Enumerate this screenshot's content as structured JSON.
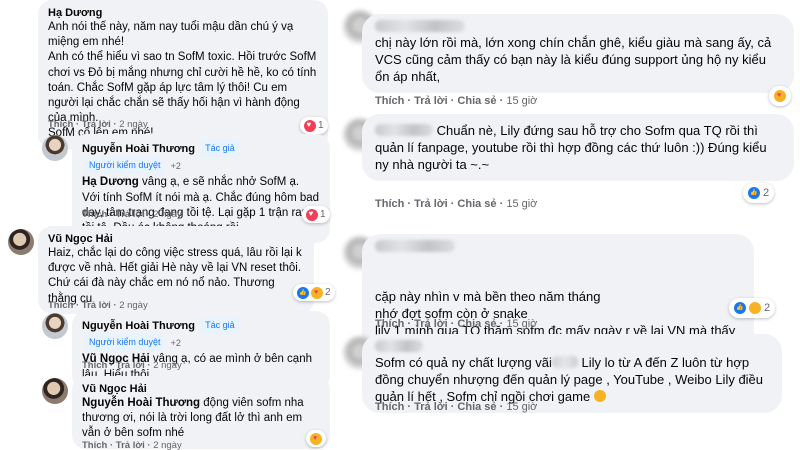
{
  "left": {
    "c1": {
      "author": "Hạ Dương",
      "text": "Anh nói thế này, năm nay tuổi mậu dần chú ý vạ miệng em nhé!\nAnh có thể hiểu vì sao tn SofM toxic. Hồi trước SofM chơi vs Đỏ bị mắng nhưng chỉ cười hề hề, ko có tính toán. Chắc SofM gặp áp lực tâm lý thôi! Cu em người lại chắc chắn sẽ thấy hối hận vì hành động của mình.\nSofM cố lên em nhé!",
      "like": "Thích",
      "reply": "Trả lời",
      "time": "2 ngày",
      "react_count": "1"
    },
    "c2": {
      "author": "Nguyễn Hoài Thương",
      "badge1": "Tác giả",
      "badge2": "Người kiểm duyệt",
      "badge_plus": "+2",
      "mention": "Hạ Dương",
      "text": " vâng ạ, e sẽ nhắc nhở SofM ạ. Với tính SofM ít nói mà ạ. Chắc đúng hôm bad day, tâm trạng đang tồi tệ. Lại gặp 1 trận rank tồi tệ. Đầu óc không thoáng rồi.",
      "like": "Thích",
      "reply": "Trả lời",
      "time": "2 ngày",
      "react_count": "1"
    },
    "c3": {
      "author": "Vũ Ngọc Hải",
      "text": "Haiz, chắc lại do công việc stress quá, lâu rồi lại k được về nhà. Hết giải Hè này về lại VN reset thôi. Chứ cái đà này chắc em nó nổ nảo. Thương thằng cu",
      "like": "Thích",
      "reply": "Trả lời",
      "time": "2 ngày",
      "react_count": "2"
    },
    "c4": {
      "author": "Nguyễn Hoài Thương",
      "badge1": "Tác giả",
      "badge2": "Người kiểm duyệt",
      "badge_plus": "+2",
      "mention": "Vũ Ngọc Hải",
      "text": " vâng ạ, có ae mình ở bên cạnh lâu. Hiểu thôi.",
      "like": "Thích",
      "reply": "Trả lời",
      "time": "2 ngày"
    },
    "c5": {
      "author": "Vũ Ngọc Hải",
      "mention": "Nguyễn Hoài Thương",
      "text": " động viên sofm nha thương ơi, nói là trời long đất lở thì anh em vẫn ở bên sofm nhé",
      "like": "Thích",
      "reply": "Trả lời",
      "time": "2 ngày"
    }
  },
  "right": {
    "r1": {
      "text": "chị này lớn rồi mà, lớn xong chín chắn ghê, kiểu giàu mà sang ấy, cả VCS cũng cảm thấy có bạn này là kiểu đúng support ủng hộ ny kiểu ổn áp nhất,",
      "like": "Thích",
      "reply": "Trả lời",
      "share": "Chia sẻ",
      "time": "15 giờ"
    },
    "r2": {
      "text": " Chuẩn nè, Lily đứng sau hỗ trợ cho Sofm qua TQ rồi thì quản lí fanpage, youtube rồi thì hợp đồng các thứ luôn :)) Đúng kiểu ny nhà người ta ~.~",
      "like": "Thích",
      "reply": "Trả lời",
      "share": "Chia sẻ",
      "time": "15 giờ",
      "react_count": "2"
    },
    "r3": {
      "text": "cặp này nhìn v mà bền theo năm tháng\nnhớ đợt sofm còn ở snake\nlily 1 mình qua TQ thăm sofm đc mấy ngày r về lại VN mà thấy thương",
      "like": "Thích",
      "reply": "Trả lời",
      "share": "Chia sẻ",
      "time": "15 giờ",
      "react_count": "2"
    },
    "r4": {
      "text_a": "Sofm có quả ny chất lượng vãi",
      "text_b": " Lily lo từ A đến Z luôn từ hợp đồng chuyển nhượng đến quản lý page , YouTube , Weibo Lily điều quản lí hết , Sofm chỉ ngồi chơi game",
      "like": "Thích",
      "reply": "Trả lời",
      "share": "Chia sẻ",
      "time": "15 giờ"
    }
  },
  "colors": {
    "bubble": "#f0f2f5",
    "secondary_text": "#65676b",
    "badge_text": "#1877f2",
    "heart": "#f33e58",
    "like": "#1877f2",
    "emoji": "#f7b125"
  }
}
